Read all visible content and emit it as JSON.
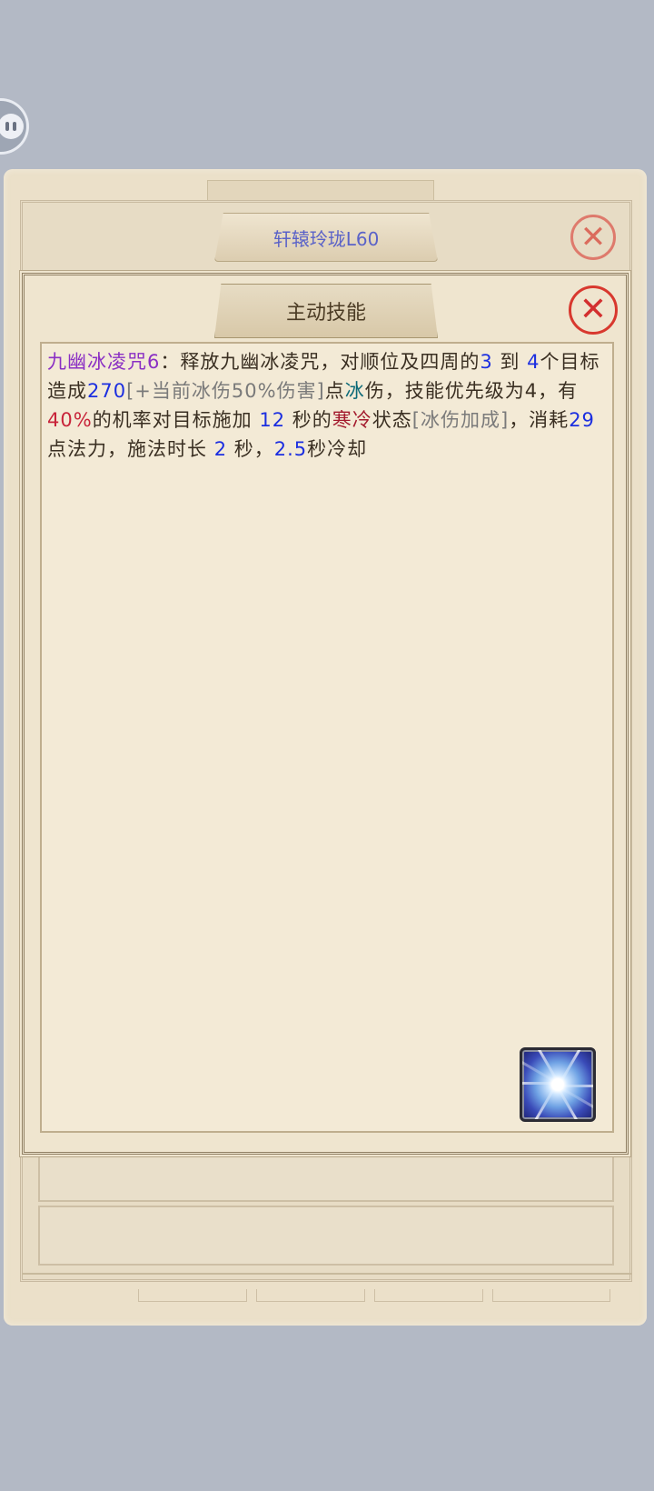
{
  "outer_window": {
    "title": "轩辕玲珑L60",
    "close_glyph": "✕"
  },
  "inner_window": {
    "title": "主动技能",
    "close_glyph": "✕"
  },
  "skill": {
    "desc_segments": [
      {
        "text": "九幽冰凌咒6",
        "color": "purple"
      },
      {
        "text": "：释放九幽冰凌咒，对顺位及四周的",
        "color": "default"
      },
      {
        "text": "3",
        "color": "blue"
      },
      {
        "text": " 到 ",
        "color": "default"
      },
      {
        "text": "4",
        "color": "blue"
      },
      {
        "text": "个目标造成",
        "color": "default"
      },
      {
        "text": "270",
        "color": "blue"
      },
      {
        "text": "[+当前冰伤50%伤害]",
        "color": "gray"
      },
      {
        "text": "点",
        "color": "default"
      },
      {
        "text": "冰",
        "color": "teal"
      },
      {
        "text": "伤，技能优先级为4，有",
        "color": "default"
      },
      {
        "text": "40%",
        "color": "red"
      },
      {
        "text": "的机率对目标施加 ",
        "color": "default"
      },
      {
        "text": "12",
        "color": "blue"
      },
      {
        "text": " 秒的",
        "color": "default"
      },
      {
        "text": "寒冷",
        "color": "dred"
      },
      {
        "text": "状态",
        "color": "default"
      },
      {
        "text": "[冰伤加成]",
        "color": "gray"
      },
      {
        "text": "，消耗",
        "color": "default"
      },
      {
        "text": "29",
        "color": "blue"
      },
      {
        "text": "点法力，施法时长 ",
        "color": "default"
      },
      {
        "text": "2",
        "color": "blue"
      },
      {
        "text": " 秒，",
        "color": "default"
      },
      {
        "text": "2.5",
        "color": "blue"
      },
      {
        "text": "秒冷却",
        "color": "default"
      }
    ],
    "icon": "snowflake-icon"
  },
  "colors": {
    "purple": "#8a2fc4",
    "blue": "#1c2fe0",
    "gray": "#7a7a7a",
    "teal": "#0d6a78",
    "red": "#c8243a",
    "dred": "#a31a2d",
    "close_red": "#d8382e",
    "parchment": "#efe5cf",
    "background": "#b3b9c5"
  }
}
